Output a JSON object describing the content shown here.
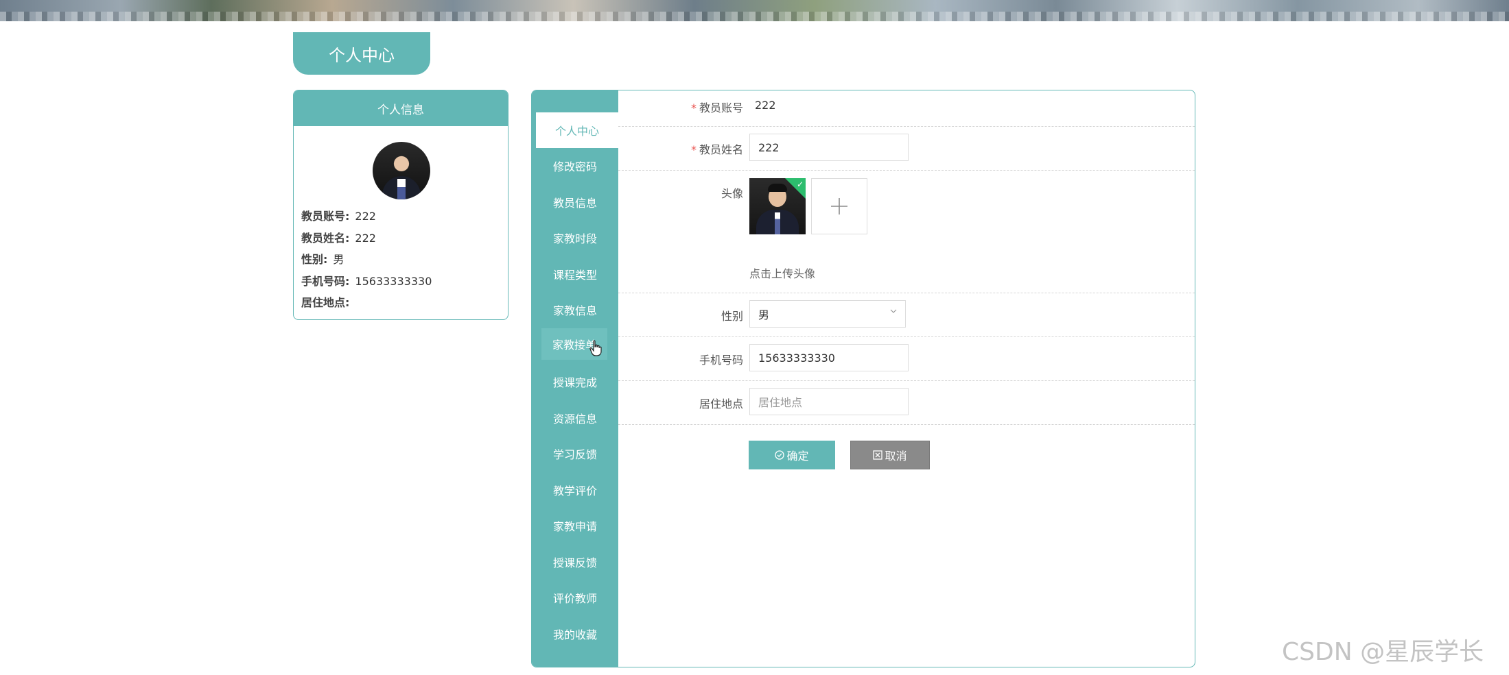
{
  "page": {
    "tab_title": "个人中心",
    "accent_color": "#62b7b5"
  },
  "profile_card": {
    "header": "个人信息",
    "rows": [
      {
        "label": "教员账号:",
        "value": "222"
      },
      {
        "label": "教员姓名:",
        "value": "222"
      },
      {
        "label": "性别:",
        "value": "男"
      },
      {
        "label": "手机号码:",
        "value": "15633333330"
      },
      {
        "label": "居住地点:",
        "value": ""
      }
    ]
  },
  "sidebar": {
    "items": [
      {
        "label": "个人中心",
        "state": "active"
      },
      {
        "label": "修改密码"
      },
      {
        "label": "教员信息"
      },
      {
        "label": "家教时段"
      },
      {
        "label": "课程类型"
      },
      {
        "label": "家教信息"
      },
      {
        "label": "家教接单",
        "state": "hover"
      },
      {
        "label": "授课完成"
      },
      {
        "label": "资源信息"
      },
      {
        "label": "学习反馈"
      },
      {
        "label": "教学评价"
      },
      {
        "label": "家教申请"
      },
      {
        "label": "授课反馈"
      },
      {
        "label": "评价教师"
      },
      {
        "label": "我的收藏"
      }
    ]
  },
  "form": {
    "account": {
      "label": "教员账号",
      "value": "222",
      "required": true
    },
    "name": {
      "label": "教员姓名",
      "value": "222",
      "required": true
    },
    "avatar": {
      "label": "头像",
      "upload_hint": "点击上传头像",
      "upload_icon": "plus-icon",
      "success_icon": "check-icon"
    },
    "gender": {
      "label": "性别",
      "value": "男",
      "icon": "chevron-down-icon"
    },
    "phone": {
      "label": "手机号码",
      "value": "15633333330"
    },
    "address": {
      "label": "居住地点",
      "value": "",
      "placeholder": "居住地点"
    },
    "confirm_label": "确定",
    "cancel_label": "取消"
  },
  "watermark": "CSDN @星辰学长"
}
